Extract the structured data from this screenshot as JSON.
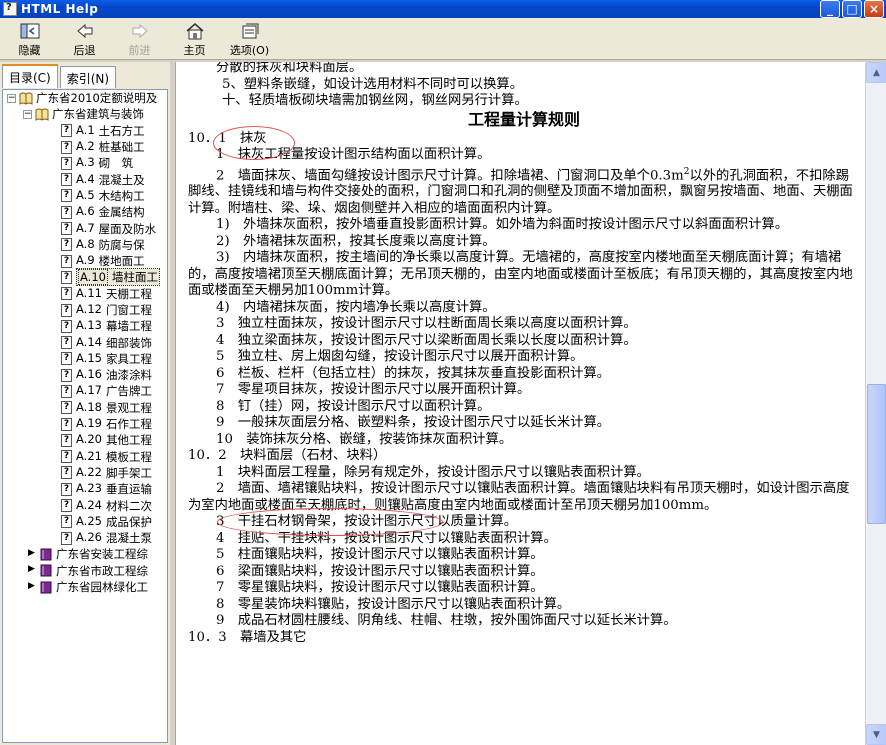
{
  "window": {
    "title": "HTML Help"
  },
  "toolbar": {
    "buttons": [
      {
        "label": "隐藏",
        "icon": "hide-icon"
      },
      {
        "label": "后退",
        "icon": "back-arrow-icon"
      },
      {
        "label": "前进",
        "icon": "forward-arrow-icon"
      },
      {
        "label": "主页",
        "icon": "home-icon"
      },
      {
        "label": "选项(O)",
        "icon": "options-icon"
      }
    ]
  },
  "tabs": {
    "contents": "目录(C)",
    "index": "索引(N)"
  },
  "tree": {
    "root": "广东省2010定额说明及",
    "sub": "广东省建筑与装饰",
    "items": [
      {
        "code": "A.1",
        "name": "土石方工"
      },
      {
        "code": "A.2",
        "name": "桩基础工"
      },
      {
        "code": "A.3",
        "name": "砌　筑"
      },
      {
        "code": "A.4",
        "name": "混凝土及"
      },
      {
        "code": "A.5",
        "name": "木结构工"
      },
      {
        "code": "A.6",
        "name": "金属结构"
      },
      {
        "code": "A.7",
        "name": "屋面及防水"
      },
      {
        "code": "A.8",
        "name": "防腐与保"
      },
      {
        "code": "A.9",
        "name": "楼地面工"
      },
      {
        "code": "A.10",
        "name": "墙柱面工"
      },
      {
        "code": "A.11",
        "name": "天棚工程"
      },
      {
        "code": "A.12",
        "name": "门窗工程"
      },
      {
        "code": "A.13",
        "name": "幕墙工程"
      },
      {
        "code": "A.14",
        "name": "细部装饰"
      },
      {
        "code": "A.15",
        "name": "家具工程"
      },
      {
        "code": "A.16",
        "name": "油漆涂料"
      },
      {
        "code": "A.17",
        "name": "广告牌工"
      },
      {
        "code": "A.18",
        "name": "景观工程"
      },
      {
        "code": "A.19",
        "name": "石作工程"
      },
      {
        "code": "A.20",
        "name": "其他工程"
      },
      {
        "code": "A.21",
        "name": "模板工程"
      },
      {
        "code": "A.22",
        "name": "脚手架工"
      },
      {
        "code": "A.23",
        "name": "垂直运输"
      },
      {
        "code": "A.24",
        "name": "材料二次"
      },
      {
        "code": "A.25",
        "name": "成品保护"
      },
      {
        "code": "A.26",
        "name": "混凝土泵"
      }
    ],
    "others": [
      "广东省安装工程综",
      "广东省市政工程综",
      "广东省园林绿化工"
    ]
  },
  "doc": {
    "l1": "分散的抹灰和块料面层。",
    "l2": "5、塑料条嵌缝，如设计选用材料不同时可以换算。",
    "l3": "十、轻质墙板砌块墙需加钢丝网，钢丝网另行计算。",
    "heading": "工程量计算规则",
    "s1": "10．1　抹灰",
    "p1": "1　抹灰工程量按设计图示结构面以面积计算。",
    "p2a": "2　墙面抹灰、墙面勾缝按设计图示尺寸计算。扣除墙裙、门窗洞口及单个0.3m",
    "p2sup": "2",
    "p2b": "以外的孔洞面积，不扣除踢脚线、挂镜线和墙与构件交接处的面积，门窗洞口和孔洞的侧壁及顶面不增加面积，飘窗另按墙面、地面、天棚面计算。附墙柱、梁、垛、烟囱侧壁并入相应的墙面面积内计算。",
    "p3": "1)　外墙抹灰面积，按外墙垂直投影面积计算。如外墙为斜面时按设计图示尺寸以斜面面积计算。",
    "p4": "2)　外墙裙抹灰面积，按其长度乘以高度计算。",
    "p5": "3)　内墙抹灰面积，按主墙间的净长乘以高度计算。无墙裙的，高度按室内楼地面至天棚底面计算；有墙裙的，高度按墙裙顶至天棚底面计算；无吊顶天棚的，由室内地面或楼面计至板底；有吊顶天棚的，其高度按室内地面或楼面至天棚另加100mm计算。",
    "p6": "4)　内墙裙抹灰面，按内墙净长乘以高度计算。",
    "p7": "3　独立柱面抹灰，按设计图示尺寸以柱断面周长乘以高度以面积计算。",
    "p8": "4　独立梁面抹灰，按设计图示尺寸以梁断面周长乘以长度以面积计算。",
    "p9": "5　独立柱、房上烟囱勾缝，按设计图示尺寸以展开面积计算。",
    "p10": "6　栏板、栏杆（包括立柱）的抹灰，按其抹灰垂直投影面积计算。",
    "p11": "7　零星项目抹灰，按设计图示尺寸以展开面积计算。",
    "p12": "8　钉（挂）网，按设计图示尺寸以面积计算。",
    "p13": "9　一般抹灰面层分格、嵌塑料条，按设计图示尺寸以延长米计算。",
    "p14": "10　装饰抹灰分格、嵌缝，按装饰抹灰面积计算。",
    "s2": "10．2　块料面层（石材、块料）",
    "q1": "1　块料面层工程量，除另有规定外，按设计图示尺寸以镶贴表面积计算。",
    "q2": "2　墙面、墙裙镶贴块料，按设计图示尺寸以镶贴表面积计算。墙面镶贴块料有吊顶天棚时，如设计图示高度为室内地面或楼面至天棚底时，则镶贴高度由室内地面或楼面计至吊顶天棚另加100mm。",
    "q3": "3　干挂石材钢骨架，按设计图示尺寸以质量计算。",
    "q4": "4　挂贴、干挂块料，按设计图示尺寸以镶贴表面积计算。",
    "q5": "5　柱面镶贴块料，按设计图示尺寸以镶贴表面积计算。",
    "q6": "6　梁面镶贴块料，按设计图示尺寸以镶贴表面积计算。",
    "q7": "7　零星镶贴块料，按设计图示尺寸以镶贴表面积计算。",
    "q8": "8　零星装饰块料镶贴，按设计图示尺寸以镶贴表面积计算。",
    "q9": "9　成品石材圆柱腰线、阴角线、柱帽、柱墩，按外围饰面尺寸以延长米计算。",
    "q10": "10．3　幕墙及其它"
  }
}
